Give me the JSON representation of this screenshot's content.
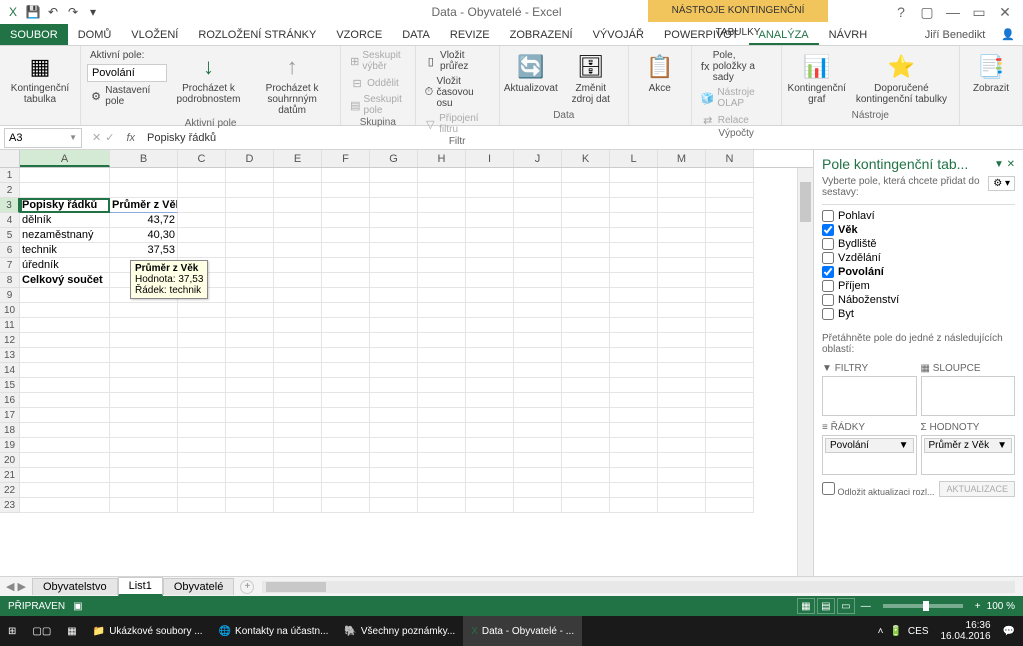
{
  "titlebar": {
    "title": "Data - Obyvatelé - Excel",
    "context_tool": "NÁSTROJE KONTINGENČNÍ TABULKY"
  },
  "user": "Jiří Benedikt",
  "win_controls": [
    "?",
    "▢",
    "—",
    "▭",
    "✕"
  ],
  "tabs": {
    "file": "SOUBOR",
    "list": [
      "DOMŮ",
      "VLOŽENÍ",
      "ROZLOŽENÍ STRÁNKY",
      "VZORCE",
      "DATA",
      "REVIZE",
      "ZOBRAZENÍ",
      "VÝVOJÁŘ",
      "POWERPIVOT",
      "ANALÝZA",
      "NÁVRH"
    ],
    "active": "ANALÝZA"
  },
  "ribbon": {
    "pivottable": {
      "label": "Kontingenční tabulka"
    },
    "activefield_group": "Aktivní pole",
    "activefield_label": "Aktivní pole:",
    "activefield_value": "Povolání",
    "field_settings": "Nastavení pole",
    "drilldown": "Procházet k podrobnostem",
    "drillup": "Procházet k souhrnným datům",
    "group_group": "Skupina",
    "group_sel": "Seskupit výběr",
    "ungroup": "Oddělit",
    "group_field": "Seskupit pole",
    "filter_group": "Filtr",
    "insert_slicer": "Vložit průřez",
    "insert_timeline": "Vložit časovou osu",
    "filter_conn": "Připojení filtru",
    "data_group": "Data",
    "refresh": "Aktualizovat",
    "change_source": "Změnit zdroj dat",
    "actions": "Akce",
    "calc_group": "Výpočty",
    "fields_items": "Pole, položky a sady",
    "olap": "Nástroje OLAP",
    "relations": "Relace",
    "tools_group": "Nástroje",
    "pivotchart": "Kontingenční graf",
    "recommended": "Doporučené kontingenční tabulky",
    "show": "Zobrazit"
  },
  "namebox": "A3",
  "formula": "Popisky řádků",
  "columns": [
    "A",
    "B",
    "C",
    "D",
    "E",
    "F",
    "G",
    "H",
    "I",
    "J",
    "K",
    "L",
    "M",
    "N"
  ],
  "pivot": {
    "row_header": "Popisky řádků",
    "val_header": "Průměr z Věk",
    "rows": [
      {
        "label": "dělník",
        "value": "43,72"
      },
      {
        "label": "nezaměstnaný",
        "value": "40,30"
      },
      {
        "label": "technik",
        "value": "37,53"
      },
      {
        "label": "úředník",
        "value": ""
      }
    ],
    "total_label": "Celkový součet",
    "total_value": ""
  },
  "tooltip": {
    "line1": "Průměr z Věk",
    "line2": "Hodnota: 37,53",
    "line3": "Řádek: technik"
  },
  "fieldlist": {
    "title": "Pole kontingenční tab...",
    "subtitle": "Vyberte pole, která chcete přidat do sestavy:",
    "fields": [
      {
        "name": "Pohlaví",
        "checked": false
      },
      {
        "name": "Věk",
        "checked": true
      },
      {
        "name": "Bydliště",
        "checked": false
      },
      {
        "name": "Vzdělání",
        "checked": false
      },
      {
        "name": "Povolání",
        "checked": true
      },
      {
        "name": "Příjem",
        "checked": false
      },
      {
        "name": "Náboženství",
        "checked": false
      },
      {
        "name": "Byt",
        "checked": false
      }
    ],
    "drag_label": "Přetáhněte pole do jedné z následujících oblastí:",
    "filters": "FILTRY",
    "columns": "SLOUPCE",
    "rows_h": "ŘÁDKY",
    "values_h": "HODNOTY",
    "rows_item": "Povolání",
    "values_item": "Průměr z Věk",
    "defer": "Odložit aktualizaci rozl...",
    "update": "AKTUALIZACE"
  },
  "sheets": {
    "list": [
      "Obyvatelstvo",
      "List1",
      "Obyvatelé"
    ],
    "active": "List1"
  },
  "status": {
    "ready": "PŘIPRAVEN",
    "zoom": "100 %"
  },
  "taskbar": {
    "items": [
      "Ukázkové soubory ...",
      "Kontakty na účastn...",
      "Všechny poznámky...",
      "Data - Obyvatelé - ..."
    ],
    "lang": "CES",
    "time": "16:36",
    "date": "16.04.2016"
  }
}
